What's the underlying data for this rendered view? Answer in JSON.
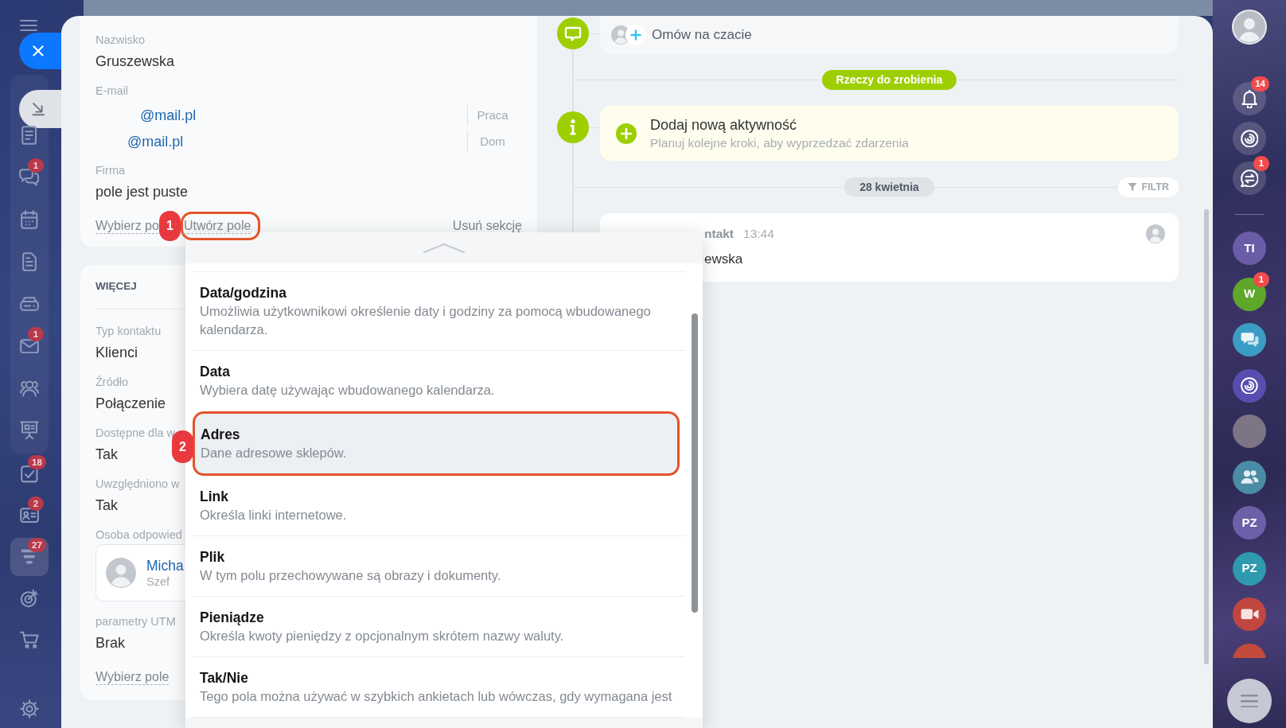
{
  "left_rail": {
    "pinned": [
      {
        "selected": false
      },
      {
        "selected": false,
        "badge": "1"
      },
      {
        "selected": false
      },
      {
        "selected": false
      },
      {
        "selected": false
      },
      {
        "selected": false,
        "badge": "1"
      },
      {
        "selected": false
      },
      {
        "selected": false
      }
    ],
    "more": [
      {
        "selected": false,
        "badge": "18"
      },
      {
        "selected": false,
        "badge": "2"
      },
      {
        "selected": true,
        "badge": "27"
      },
      {
        "selected": false
      },
      {
        "selected": false
      }
    ]
  },
  "contact_section": {
    "fields": [
      {
        "label": "Nazwisko",
        "value": "Gruszewska"
      },
      {
        "label": "E-mail",
        "emails": [
          {
            "address": "@mail.pl",
            "type": "Praca"
          },
          {
            "address": "@mail.pl",
            "type": "Dom"
          }
        ]
      },
      {
        "label": "Firma",
        "value": "pole jest puste"
      }
    ],
    "actions": [
      {
        "label": "Wybierz po"
      },
      {
        "label": "Utwórz pole",
        "annotation": "1"
      },
      {
        "label": "Usuń sekcję"
      }
    ]
  },
  "more_section": {
    "title": "WIĘCEJ",
    "fields": [
      {
        "label": "Typ kontaktu",
        "value": "Klienci"
      },
      {
        "label": "Źródło",
        "value": "Połączenie"
      },
      {
        "label": "Dostępne dla w",
        "value": "Tak"
      },
      {
        "label": "Uwzględniono w",
        "value": "Tak"
      },
      {
        "label": "Osoba odpowied",
        "person": {
          "name": "Micha",
          "role": "Szef"
        }
      },
      {
        "label": "parametry UTM",
        "value": "Brak"
      }
    ],
    "action": "Wybierz pole"
  },
  "field_menu": {
    "items": [
      {
        "title": "Data/godzina",
        "description": "Umożliwia użytkownikowi określenie daty i godziny za pomocą wbudowanego kalendarza.",
        "selected": false
      },
      {
        "title": "Data",
        "description": "Wybiera datę używając wbudowanego kalendarza.",
        "selected": false
      },
      {
        "title": "Adres",
        "description": "Dane adresowe sklepów.",
        "selected": true,
        "annotation": "2"
      },
      {
        "title": "Link",
        "description": "Określa linki internetowe.",
        "selected": false
      },
      {
        "title": "Plik",
        "description": "W tym polu przechowywane są obrazy i dokumenty.",
        "selected": false
      },
      {
        "title": "Pieniądze",
        "description": "Określa kwoty pieniędzy z opcjonalnym skrótem nazwy waluty.",
        "selected": false
      },
      {
        "title": "Tak/Nie",
        "description": "Tego pola można używać w szybkich ankietach lub wówczas, gdy wymagana jest",
        "selected": false
      }
    ]
  },
  "timeline": {
    "chat_prompt": "Omów na czacie",
    "todo_label": "Rzeczy do zrobienia",
    "new_activity": {
      "title": "Dodaj nową aktywność",
      "subtitle": "Planuj kolejne kroki, aby wyprzedzać zdarzenia"
    },
    "date_label": "28 kwietnia",
    "filter_button": "FILTR",
    "event": {
      "title": "ntakt",
      "time": "13:44",
      "text": "ewska"
    }
  },
  "right_rail": {
    "top": [
      {
        "kind": "avatar"
      },
      {
        "kind": "icon",
        "badge": "14"
      },
      {
        "kind": "icon"
      },
      {
        "kind": "icon",
        "badge": "1"
      }
    ],
    "chats": [
      {
        "kind": "initials",
        "initials": "TI",
        "color": "#6a5ca6"
      },
      {
        "kind": "initials",
        "initials": "W",
        "color": "#5ea72a",
        "badge": "1"
      },
      {
        "kind": "icon",
        "color": "#3b9cc4"
      },
      {
        "kind": "icon",
        "color": "#5a4db0"
      },
      {
        "kind": "photo"
      },
      {
        "kind": "icon",
        "color": "#4a8ba5"
      },
      {
        "kind": "initials",
        "initials": "PZ",
        "color": "#6e60a8"
      },
      {
        "kind": "initials",
        "initials": "PZ",
        "color": "#2d9aad"
      },
      {
        "kind": "icon",
        "color": "#c0463f"
      },
      {
        "kind": "blank",
        "color": "#c34a3b"
      }
    ]
  }
}
